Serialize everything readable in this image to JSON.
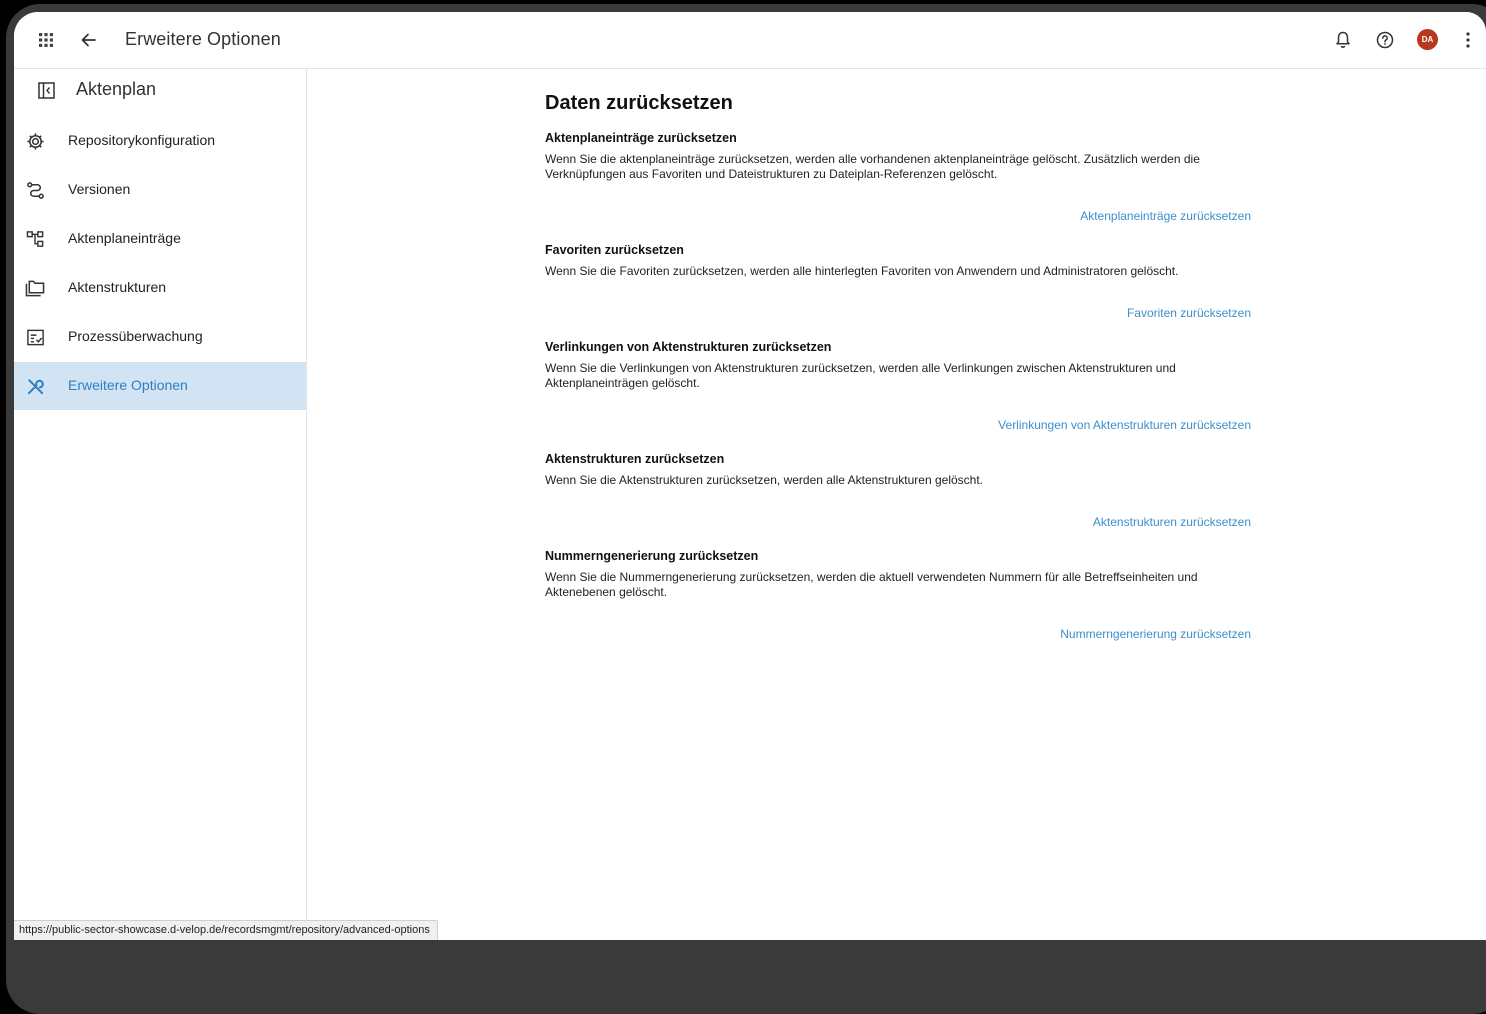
{
  "topbar": {
    "title": "Erweitere Optionen",
    "icons": [
      "apps-grid-icon",
      "back-arrow-icon",
      "bell-icon",
      "help-icon",
      "more-vert-icon"
    ],
    "avatar_initials": "DA",
    "avatar_color": "#b5391c"
  },
  "sidebar": {
    "title": "Aktenplan",
    "items": [
      {
        "label": "Repositorykonfiguration",
        "icon": "gear-icon",
        "active": false
      },
      {
        "label": "Versionen",
        "icon": "route-icon",
        "active": false
      },
      {
        "label": "Aktenplaneinträge",
        "icon": "tree-structure-icon",
        "active": false
      },
      {
        "label": "Aktenstrukturen",
        "icon": "folder-stack-icon",
        "active": false
      },
      {
        "label": "Prozessüberwachung",
        "icon": "checklist-icon",
        "active": false
      },
      {
        "label": "Erweitere Optionen",
        "icon": "tools-icon",
        "active": true
      }
    ],
    "active_color": "#d2e3f3",
    "active_text_color": "#2f7fc1"
  },
  "main": {
    "title": "Daten zurücksetzen",
    "sections": [
      {
        "heading": "Aktenplaneinträge zurücksetzen",
        "text": "Wenn Sie die aktenplaneinträge zurücksetzen, werden alle vorhandenen aktenplaneinträge gelöscht. Zusätzlich werden die Verknüpfungen aus Favoriten und Dateistrukturen zu Dateiplan-Referenzen gelöscht.",
        "link": "Aktenplaneinträge zurücksetzen"
      },
      {
        "heading": "Favoriten zurücksetzen",
        "text": "Wenn Sie die Favoriten zurücksetzen, werden alle hinterlegten Favoriten von Anwendern und Administratoren gelöscht.",
        "link": "Favoriten zurücksetzen"
      },
      {
        "heading": "Verlinkungen von Aktenstrukturen zurücksetzen",
        "text": "Wenn Sie die Verlinkungen von Aktenstrukturen zurücksetzen, werden alle Verlinkungen zwischen Aktenstrukturen und Aktenplaneinträgen gelöscht.",
        "link": "Verlinkungen von Aktenstrukturen zurücksetzen"
      },
      {
        "heading": "Aktenstrukturen zurücksetzen",
        "text": "Wenn Sie die Aktenstrukturen zurücksetzen, werden alle Aktenstrukturen gelöscht.",
        "link": "Aktenstrukturen zurücksetzen"
      },
      {
        "heading": "Nummerngenerierung zurücksetzen",
        "text": "Wenn Sie die Nummerngenerierung zurücksetzen, werden die aktuell verwendeten Nummern für alle Betreffseinheiten und Aktenebenen gelöscht.",
        "link": "Nummerngenerierung zurücksetzen"
      }
    ],
    "link_color": "#3d8fcc"
  },
  "status_bar": {
    "url": "https://public-sector-showcase.d-velop.de/recordsmgmt/repository/advanced-options"
  }
}
